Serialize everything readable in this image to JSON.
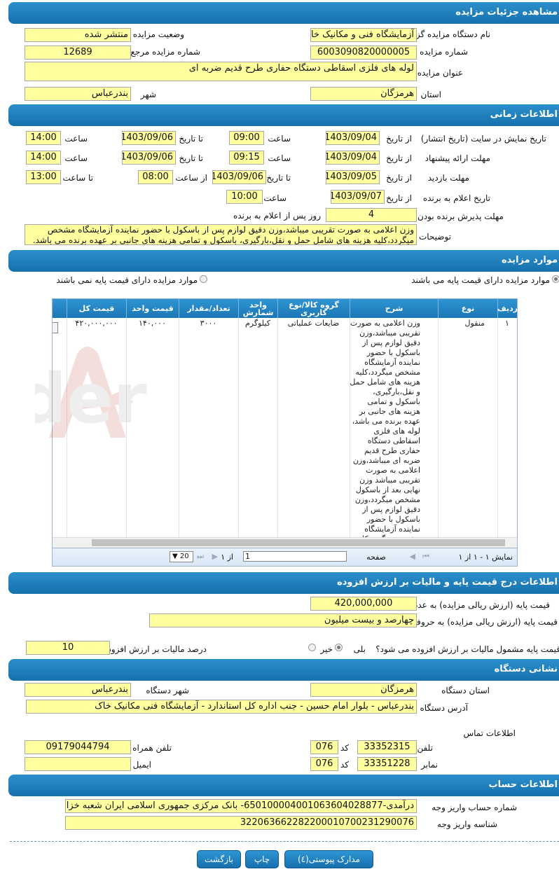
{
  "sections": {
    "details": "مشاهده جزئیات مزایده",
    "timing": "اطلاعات زمانی",
    "items": "موارد مزایده",
    "price": "اطلاعات درج قیمت پایه و مالیات بر ارزش افزوده",
    "address": "نشانی دستگاه",
    "account": "اطلاعات حساب"
  },
  "details": {
    "org_label": "نام دستگاه مزایده گزار",
    "org_value": "آزمایشگاه فنی و مکانیک خاک",
    "status_label": "وضعیت مزایده",
    "status_value": "منتشر شده",
    "number_label": "شماره مزایده",
    "number_value": "6003090820000005",
    "ref_label": "شماره مزایده مرجع",
    "ref_value": "12689",
    "title_label": "عنوان مزایده",
    "title_value": "لوله های فلزی اسقاطی دستگاه حفاری طرح قدیم ضربه ای",
    "province_label": "استان",
    "province_value": "هرمزگان",
    "city_label": "شهر",
    "city_value": "بندرعباس"
  },
  "timing": {
    "from_date": "از تاریخ",
    "to_date": "تا تاریخ",
    "time": "ساعت",
    "from_time": "از ساعت",
    "to_time": "تا ساعت",
    "display_label": "تاریخ نمایش در سایت (تاریخ انتشار)",
    "display_from": "1403/09/04",
    "display_from_time": "09:00",
    "display_to": "1403/09/06",
    "display_to_time": "14:00",
    "offer_label": "مهلت ارائه پیشنهاد",
    "offer_from": "1403/09/04",
    "offer_from_time": "09:15",
    "offer_to": "1403/09/06",
    "offer_to_time": "14:00",
    "visit_label": "مهلت بازدید",
    "visit_from": "1403/09/05",
    "visit_to": "1403/09/06",
    "visit_from_time": "08:00",
    "visit_to_time": "13:00",
    "winner_label": "تاریخ اعلام به برنده",
    "winner_date": "1403/09/07",
    "winner_time": "10:00",
    "accept_label": "مهلت پذیرش برنده بودن",
    "accept_days": "4",
    "accept_suffix": "روز پس از اعلام به برنده",
    "notes_label": "توضیحات",
    "notes_value": "وزن اعلامی به صورت تقریبی میباشد،وزن دقیق لوازم پس از باسکول با حضور نماینده آزمایشگاه مشخص میگردد،کلیه هزینه های شامل حمل و نقل،بارگیری، باسکول و تمامی هزینه های جانبی بر عهده برنده می باشد."
  },
  "items": {
    "radio_with_price": "موارد مزایده دارای قیمت پایه می باشند",
    "radio_without_price": "موارد مزایده دارای قیمت پایه نمی باشند",
    "columns": [
      "ردیف",
      "نوع",
      "شرح",
      "گروه کالا/نوع کاربری",
      "واحد شمارش",
      "تعداد/مقدار",
      "قیمت واحد",
      "قیمت کل"
    ],
    "row": {
      "index": "۱",
      "type": "منقول",
      "description": "وزن اعلامی به صورت تقریبی میباشد،وزن دقیق لوازم پس از باسکول با حضور نماینده آزمایشگاه مشخص میگردد،کلیه هزینه های شامل حمل و نقل،بارگیری، باسکول و تمامی هزینه های جانبی بر عهده برنده می باشد، لوله های فلزی اسقاطی دستگاه حفاری طرح قدیم ضربه ای میباشد،وزن اعلامی به صورت تقریبی میباشد وزن نهایی بعد از باسکول مشخص میگردد،وزن دقیق لوازم پس از باسکول با حضور نماینده آزمایشگاه مشخص میگردد،کلیه هزینه های شامل حمل و نقل،بارگیری، باسکول و تمامی هزینه های جانبی بر عهده برنده می باشد",
      "group": "ضایعات عملیاتی",
      "unit": "کیلوگرم",
      "qty": "۳۰۰۰",
      "unit_price": "۱۴۰,۰۰۰",
      "total": "۴۲۰,۰۰۰,۰۰۰"
    },
    "pager": {
      "showing": "نمایش ۱ - ۱ از ۱",
      "page_label": "صفحه",
      "page_value": "1",
      "of_label": "از ۱",
      "page_size": "20"
    }
  },
  "price": {
    "base_num_label": "قیمت پایه (ارزش ریالی مزایده) به عدد",
    "base_num_value": "420,000,000",
    "base_words_label": "قیمت پایه (ارزش ریالی مزایده) به حروف",
    "base_words_value": "چهارصد و بیست میلیون",
    "vat_question": "قیمت پایه مشمول مالیات بر ارزش افزوده می شود؟",
    "yes": "بلی",
    "no": "خیر",
    "vat_percent_label": "درصد مالیات بر ارزش افزوده",
    "vat_percent_value": "10"
  },
  "address": {
    "province_label": "استان دستگاه",
    "province_value": "هرمزگان",
    "city_label": "شهر دستگاه",
    "city_value": "بندرعباس",
    "addr_label": "آدرس دستگاه",
    "addr_value": "بندرعباس - بلوار امام حسین - جنب اداره کل استاندارد - آزمایشگاه فنی مکانیک خاک",
    "contact_label": "اطلاعات تماس",
    "phone_label": "تلفن",
    "phone_value": "33352315",
    "code_label": "کد",
    "phone_code": "076",
    "mobile_label": "تلفن همراه",
    "mobile_value": "09179044794",
    "fax_label": "نمابر",
    "fax_value": "33351228",
    "fax_code": "076",
    "email_label": "ایمیل",
    "email_value": ""
  },
  "account": {
    "acc_label": "شماره حساب واریز وجه",
    "acc_value": "درآمدی-6501000040010636040288​77- بانک مرکزی جمهوری اسلامی ایران شعبه خزانه داری",
    "id_label": "شناسه واریز وجه",
    "id_value": "322063662282200010700231290076"
  },
  "buttons": {
    "docs": "مدارک پیوستی(٤)",
    "print": "چاپ",
    "back": "بازگشت"
  },
  "watermark": "AriaTender",
  "colors": {
    "header": "#1b78b6",
    "field": "#ffffa0"
  }
}
